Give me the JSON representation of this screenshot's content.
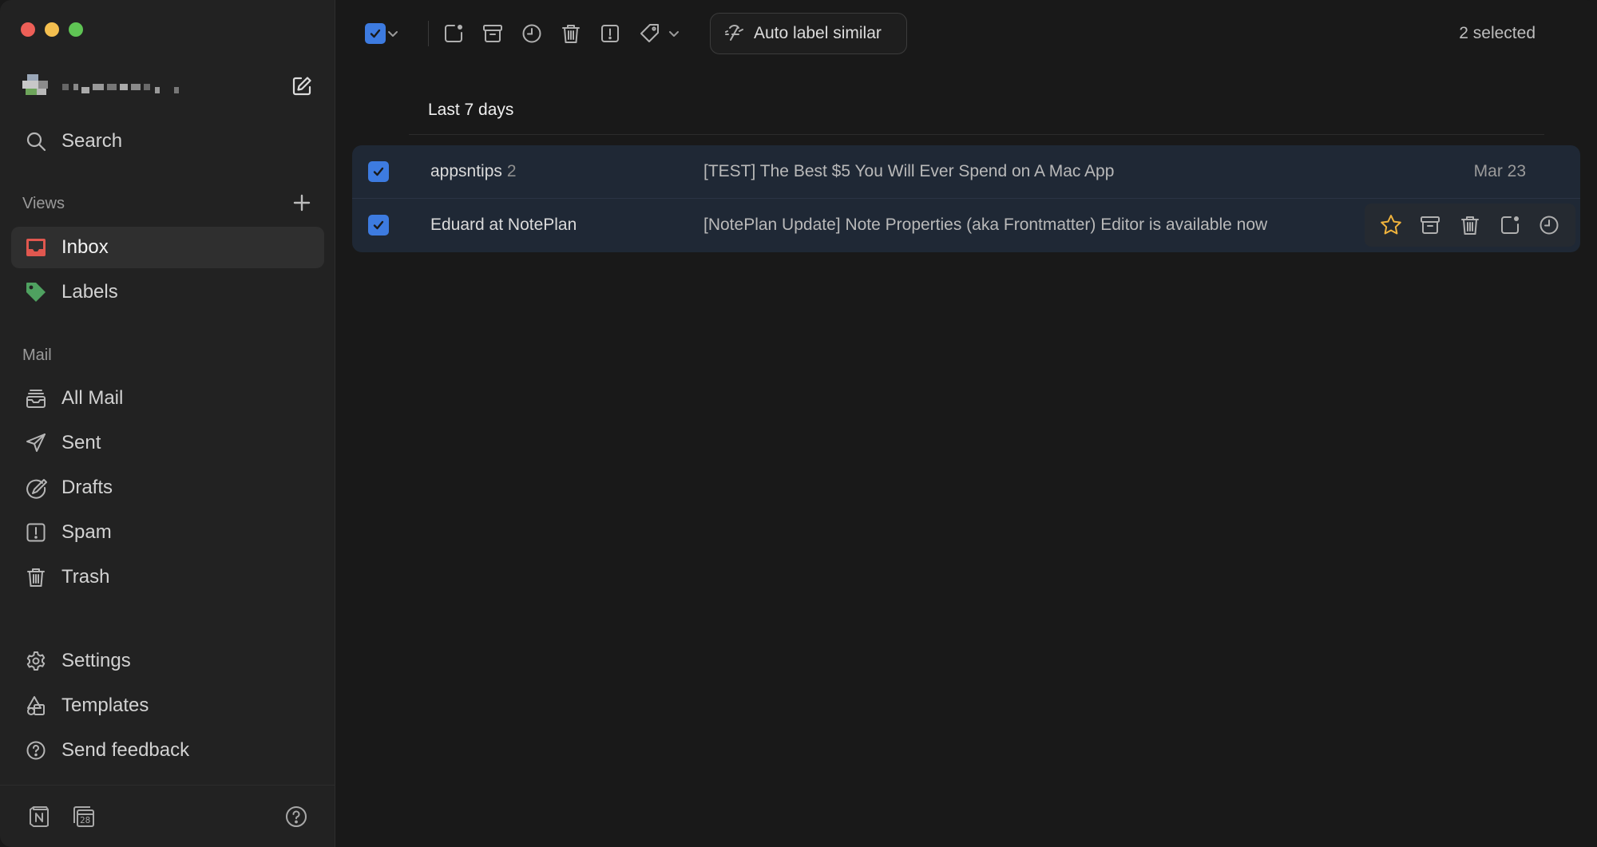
{
  "window": {
    "traffic_lights": [
      "close",
      "minimize",
      "zoom"
    ],
    "colors": {
      "close": "#ed5f57",
      "minimize": "#f4bf4f",
      "zoom": "#5fc454"
    }
  },
  "sidebar": {
    "account": {
      "avatar_icon": "pixelated-avatar",
      "name": ""
    },
    "compose_icon": "compose-icon",
    "search": {
      "label": "Search",
      "icon": "search-icon"
    },
    "views_title": "Views",
    "views": [
      {
        "label": "Inbox",
        "icon": "inbox-icon",
        "active": true
      },
      {
        "label": "Labels",
        "icon": "tag-icon",
        "active": false
      }
    ],
    "mail_title": "Mail",
    "mail": [
      {
        "label": "All Mail",
        "icon": "all-mail-icon"
      },
      {
        "label": "Sent",
        "icon": "paper-plane-icon"
      },
      {
        "label": "Drafts",
        "icon": "draft-icon"
      },
      {
        "label": "Spam",
        "icon": "spam-icon"
      },
      {
        "label": "Trash",
        "icon": "trash-icon"
      }
    ],
    "bottom": [
      {
        "label": "Settings",
        "icon": "gear-icon"
      },
      {
        "label": "Templates",
        "icon": "templates-icon"
      },
      {
        "label": "Send feedback",
        "icon": "help-circle-icon"
      }
    ],
    "footer_icons": [
      "notion-icon",
      "calendar-icon",
      "help-icon"
    ],
    "calendar_day": "28"
  },
  "toolbar": {
    "select_all_checked": true,
    "auto_label": "Auto label similar",
    "selected_count": "2 selected"
  },
  "list": {
    "group_title": "Last 7 days",
    "rows": [
      {
        "sender": "appsntips",
        "thread_count": "2",
        "subject": "[TEST] The Best $5 You Will Ever Spend on A Mac App",
        "date": "Mar 23",
        "checked": true
      },
      {
        "sender": "Eduard at NotePlan",
        "thread_count": "",
        "subject": "[NotePlan Update] Note Properties (aka Frontmatter) Editor is available now",
        "date": "",
        "checked": true,
        "hover_actions": [
          "star-icon",
          "archive-icon",
          "trash-icon",
          "mark-unread-icon",
          "snooze-icon"
        ]
      }
    ]
  },
  "colors": {
    "accent": "#3d7be0",
    "inbox_icon": "#e0574f",
    "labels_icon": "#4fa160",
    "star": "#f0b33d",
    "selection_row": "#1f2835"
  }
}
